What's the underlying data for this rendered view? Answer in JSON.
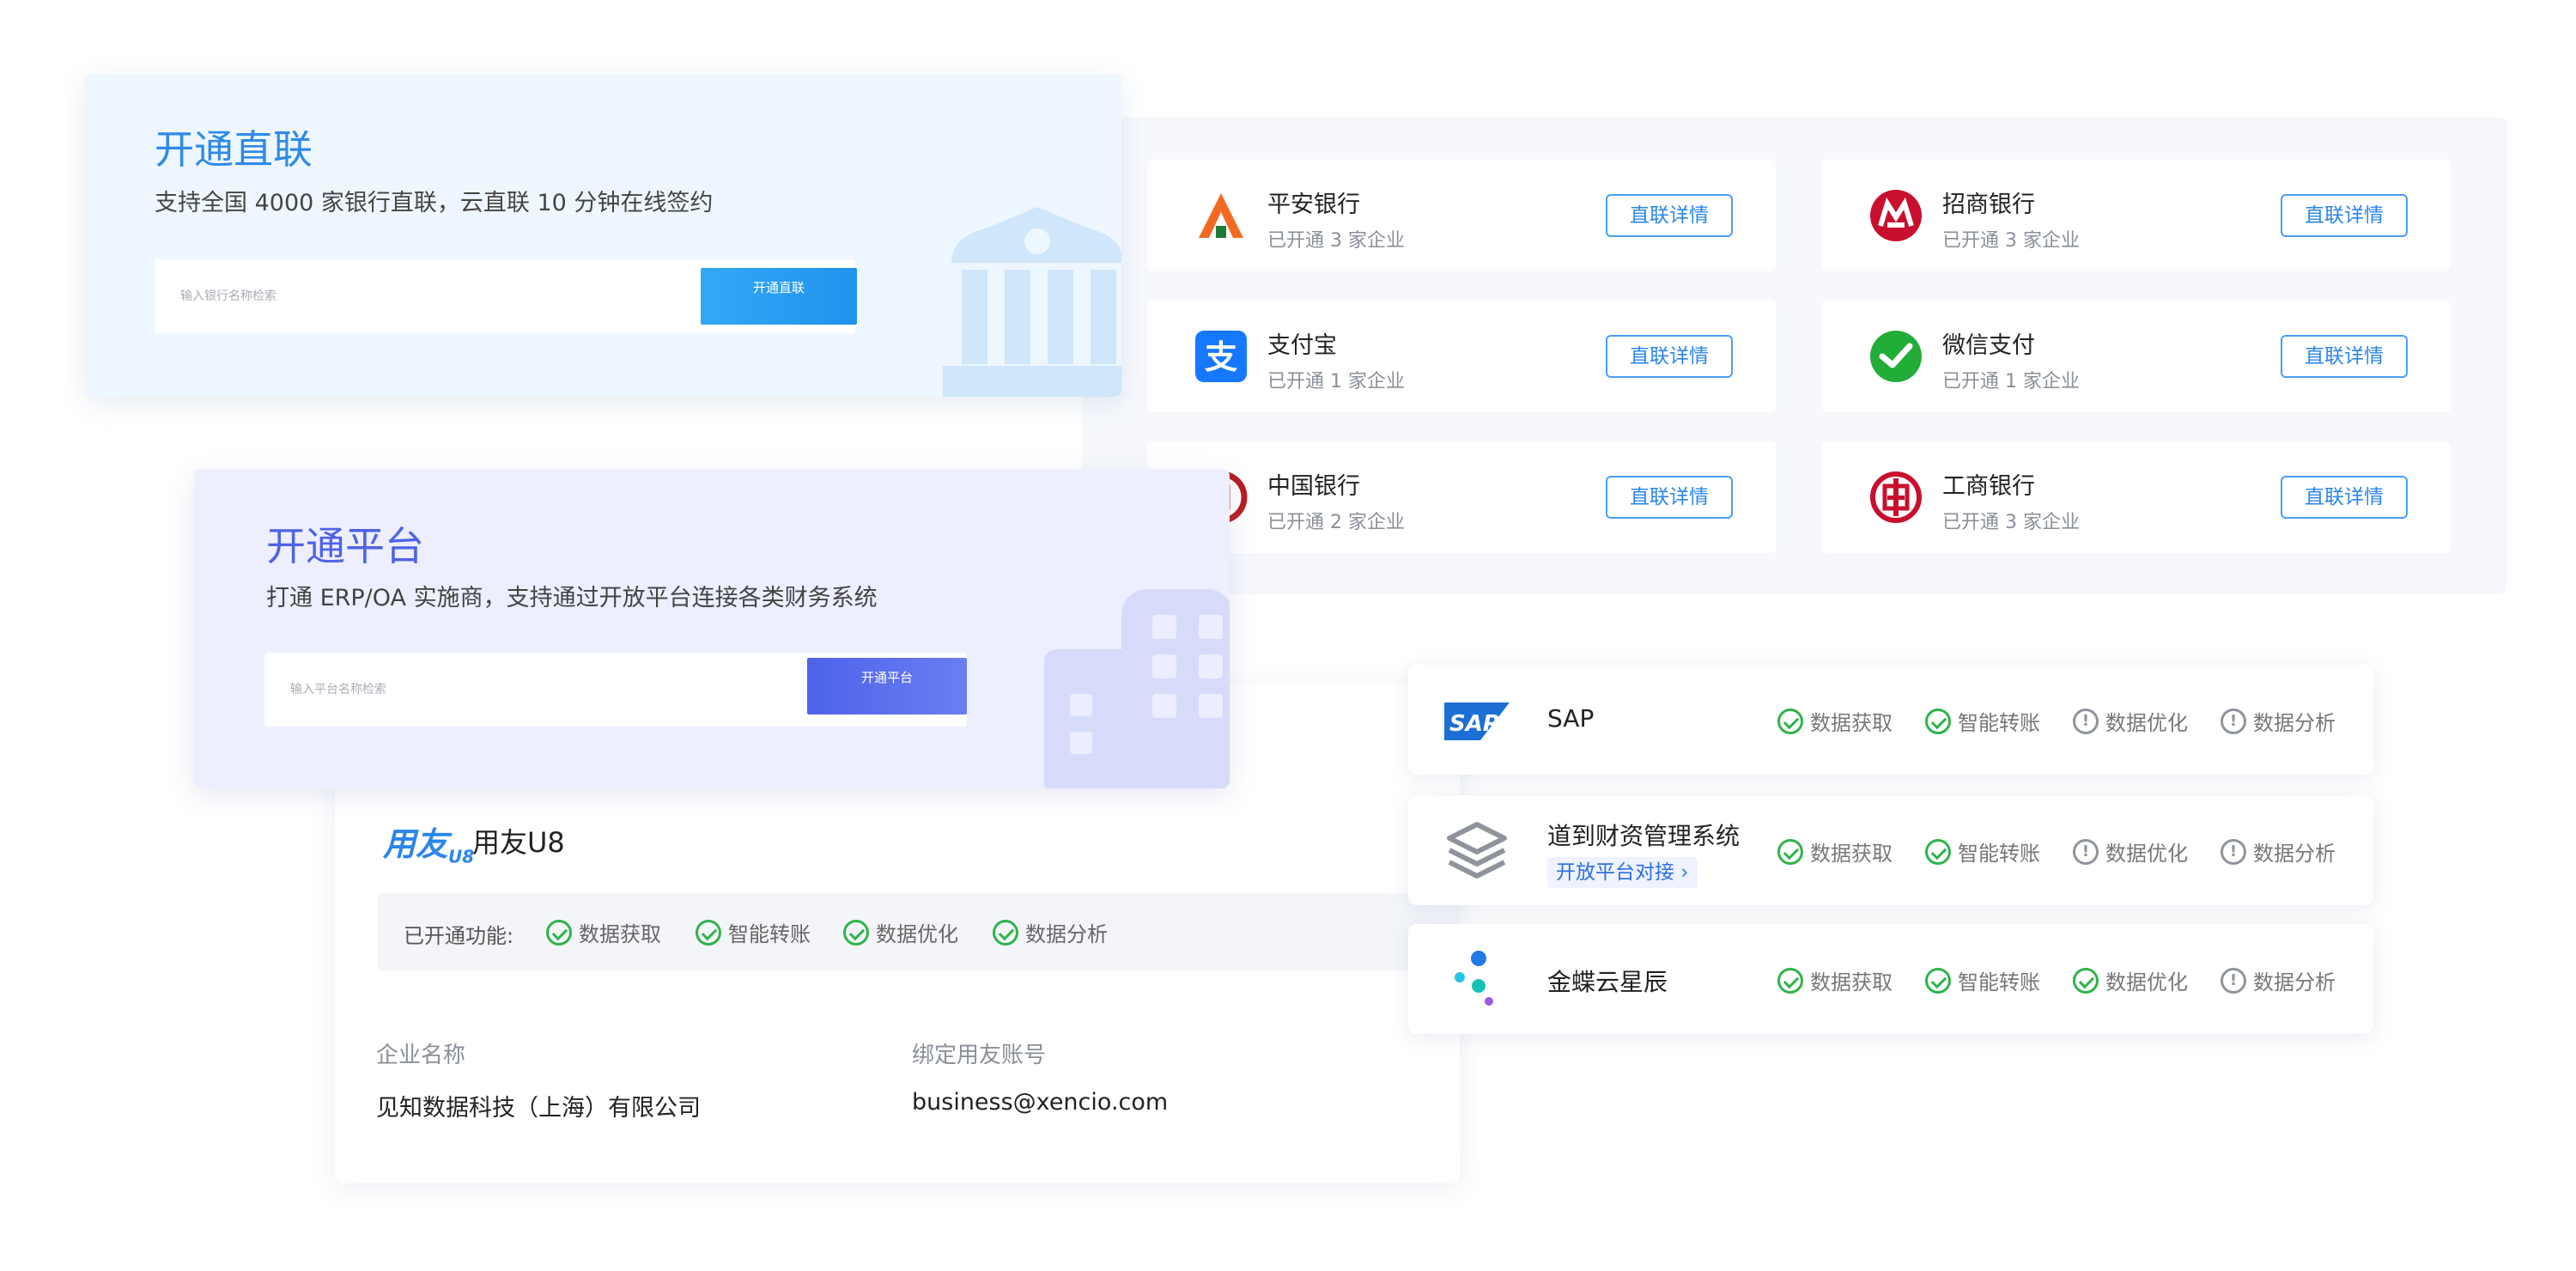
{
  "direct": {
    "title": "开通直联",
    "desc": "支持全国 4000 家银行直联，云直联 10 分钟在线签约",
    "placeholder": "输入银行名称检索",
    "button": "开通直联"
  },
  "banks": [
    {
      "name": "平安银行",
      "sub": "已开通 3 家企业",
      "button": "直联详情",
      "icon": "pingan-bank-logo"
    },
    {
      "name": "招商银行",
      "sub": "已开通 3 家企业",
      "button": "直联详情",
      "icon": "cmb-bank-logo"
    },
    {
      "name": "支付宝",
      "sub": "已开通 1 家企业",
      "button": "直联详情",
      "icon": "alipay-logo"
    },
    {
      "name": "微信支付",
      "sub": "已开通 1 家企业",
      "button": "直联详情",
      "icon": "wechat-pay-logo"
    },
    {
      "name": "中国银行",
      "sub": "已开通 2 家企业",
      "button": "直联详情",
      "icon": "boc-bank-logo"
    },
    {
      "name": "工商银行",
      "sub": "已开通 3 家企业",
      "button": "直联详情",
      "icon": "icbc-bank-logo"
    }
  ],
  "platform": {
    "title": "开通平台",
    "desc": "打通 ERP/OA 实施商，支持通过开放平台连接各类财务系统",
    "placeholder": "输入平台名称检索",
    "button": "开通平台"
  },
  "u8": {
    "logo_text": "用友",
    "logo_sub": "U8",
    "name": "用友U8",
    "func_label": "已开通功能:",
    "funcs": [
      "数据获取",
      "智能转账",
      "数据优化",
      "数据分析"
    ],
    "company_label": "企业名称",
    "company_value": "见知数据科技（上海）有限公司",
    "account_label": "绑定用友账号",
    "account_value": "business@xencio.com",
    "close_glyph": "×"
  },
  "integrations": [
    {
      "name": "SAP",
      "icon": "sap-logo",
      "funcs": [
        {
          "label": "数据获取",
          "status": "ok"
        },
        {
          "label": "智能转账",
          "status": "ok"
        },
        {
          "label": "数据优化",
          "status": "warn"
        },
        {
          "label": "数据分析",
          "status": "warn"
        }
      ]
    },
    {
      "name": "道到财资管理系统",
      "tag": "开放平台对接 ›",
      "icon": "layers-logo",
      "funcs": [
        {
          "label": "数据获取",
          "status": "ok"
        },
        {
          "label": "智能转账",
          "status": "ok"
        },
        {
          "label": "数据优化",
          "status": "warn"
        },
        {
          "label": "数据分析",
          "status": "warn"
        }
      ]
    },
    {
      "name": "金蝶云星辰",
      "icon": "kingdee-logo",
      "funcs": [
        {
          "label": "数据获取",
          "status": "ok"
        },
        {
          "label": "智能转账",
          "status": "ok"
        },
        {
          "label": "数据优化",
          "status": "ok"
        },
        {
          "label": "数据分析",
          "status": "warn"
        }
      ]
    }
  ],
  "colors": {
    "blue": "#2f8be6",
    "indigo": "#4f62e6",
    "green": "#2fb34a",
    "grey": "#8f949c"
  }
}
